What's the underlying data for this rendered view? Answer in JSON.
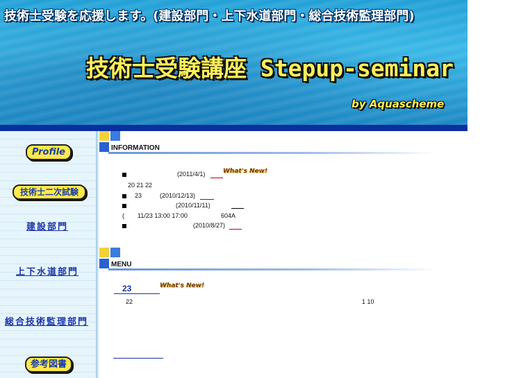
{
  "banner": {
    "subtitle": "技術士受験を応援します。(建設部門・上下水道部門・総合技術監理部門)",
    "title": "技術士受験講座 Stepup-seminar",
    "byline": "by Aquascheme"
  },
  "sidebar": {
    "profile": "Profile",
    "exam": "技術士二次試験",
    "kensetsu": "建設部門",
    "suido": "上下水道部門",
    "sogo": "総合技術監理部門",
    "books": "参考図書"
  },
  "information": {
    "heading": "INFORMATION",
    "whats_new": "What's New!",
    "items": [
      {
        "date": "(2011/4/1)",
        "extra": "20 21 22"
      },
      {
        "num": "23",
        "date": "(2010/12/13)"
      },
      {
        "date": "(2010/11/11)",
        "extra": "(",
        "time": "11/23 13:00 17:00",
        "room": "604A"
      },
      {
        "date": "(2010/8/27)"
      }
    ]
  },
  "menu": {
    "heading": "MENU",
    "link_num": "23",
    "whats_new": "What's New!",
    "text_left": "22",
    "text_right": "1 10"
  },
  "colors": {
    "banner_blue": "#2aa0d6",
    "nav_bar": "#0a2fa0",
    "link_blue": "#1a34a8",
    "pill_yellow": "#ffe94a",
    "underline_red": "#c00000"
  }
}
